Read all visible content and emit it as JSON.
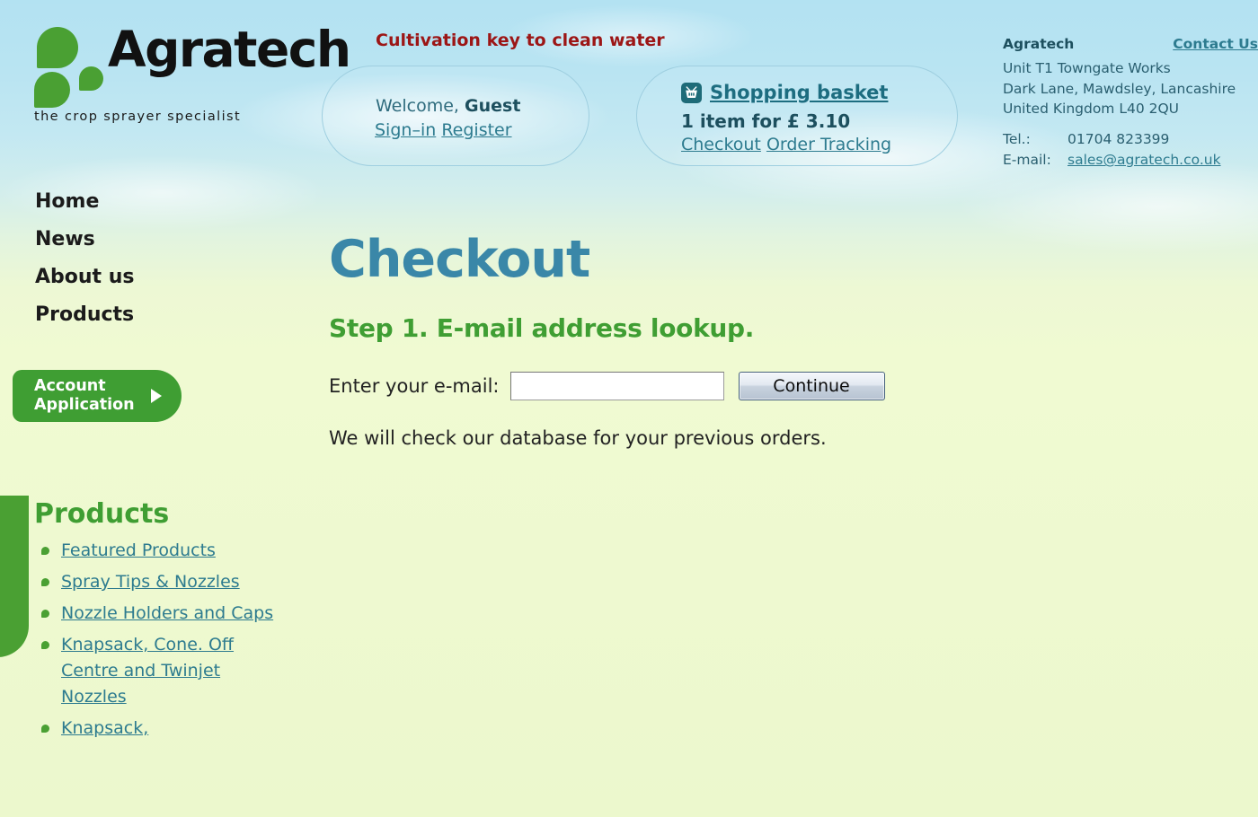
{
  "brand": {
    "name": "Agratech",
    "tagline": "the crop sprayer specialist",
    "logo_icon": "three-leaf-logo"
  },
  "slogan": "Cultivation key to clean water",
  "account_box": {
    "welcome_prefix": "Welcome,",
    "user": "Guest",
    "signin_label": "Sign–in",
    "register_label": "Register"
  },
  "basket_box": {
    "icon": "shopping-basket-icon",
    "title": "Shopping basket",
    "summary": "1 item for £ 3.10",
    "checkout_label": "Checkout",
    "order_tracking_label": "Order Tracking"
  },
  "contact": {
    "company": "Agratech",
    "contact_us_label": "Contact Us",
    "address_line1": "Unit T1 Towngate Works",
    "address_line2": "Dark Lane, Mawdsley, Lancashire",
    "address_line3": "United Kingdom L40 2QU",
    "tel_label": "Tel.:",
    "tel_value": "01704 823399",
    "email_label": "E-mail:",
    "email_value": "sales@agratech.co.uk"
  },
  "nav": {
    "items": [
      {
        "label": "Home"
      },
      {
        "label": "News"
      },
      {
        "label": "About us"
      },
      {
        "label": "Products"
      }
    ]
  },
  "account_application": {
    "label": "Account\nApplication",
    "arrow_icon": "triangle-right-icon"
  },
  "products_sidebar": {
    "heading": "Products",
    "items": [
      {
        "label": "Featured Products"
      },
      {
        "label": "Spray Tips & Nozzles"
      },
      {
        "label": "Nozzle Holders and Caps"
      },
      {
        "label": "Knapsack, Cone. Off Centre and Twinjet Nozzles"
      },
      {
        "label": "Knapsack,"
      }
    ]
  },
  "main": {
    "page_title": "Checkout",
    "step_title": "Step 1. E-mail address lookup.",
    "email_label": "Enter your e-mail:",
    "email_value": "",
    "email_placeholder": "",
    "continue_label": "Continue",
    "helper_text": "We will check our database for your previous orders."
  },
  "colors": {
    "sky": "#b3e2f2",
    "field": "#eef9d0",
    "green": "#3f9e33",
    "leaf_green": "#4aa033",
    "teal_link": "#2d7b8f",
    "title_blue": "#3a87a8",
    "slogan_red": "#9c1616"
  }
}
